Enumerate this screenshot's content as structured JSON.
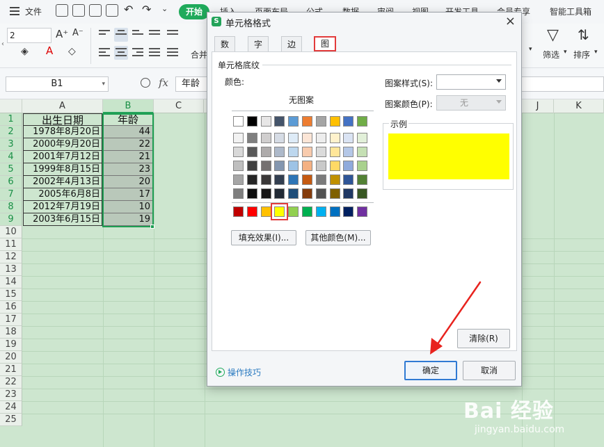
{
  "menubar": {
    "file": "文件",
    "start": "开始",
    "tabs": [
      "插入",
      "页面布局",
      "公式",
      "数据",
      "审阅",
      "视图",
      "开发工具",
      "会员专享",
      "智能工具箱"
    ]
  },
  "ribbon": {
    "font_size": "2",
    "merge_label": "合并",
    "filter_label": "筛选",
    "sort_label": "排序",
    "dropdown_marker": "▾"
  },
  "formula_bar": {
    "cell_ref": "B1",
    "fx": "fx",
    "content": "年龄"
  },
  "sheet": {
    "columns": [
      "A",
      "B",
      "C",
      "J",
      "K"
    ],
    "rows": [
      "1",
      "2",
      "3",
      "4",
      "5",
      "6",
      "7",
      "8",
      "9",
      "10",
      "11",
      "12",
      "13",
      "14",
      "15",
      "16",
      "17",
      "18",
      "19",
      "20",
      "21",
      "22",
      "23",
      "24",
      "25"
    ],
    "header_a": "出生日期",
    "header_b": "年龄",
    "data": [
      {
        "date": "1978年8月20日",
        "age": "44"
      },
      {
        "date": "2000年9月20日",
        "age": "22"
      },
      {
        "date": "2001年7月12日",
        "age": "21"
      },
      {
        "date": "1999年8月15日",
        "age": "23"
      },
      {
        "date": "2002年4月13日",
        "age": "20"
      },
      {
        "date": "2005年6月8日",
        "age": "17"
      },
      {
        "date": "2012年7月19日",
        "age": "10"
      },
      {
        "date": "2003年6月15日",
        "age": "19"
      }
    ]
  },
  "dialog": {
    "title": "单元格格式",
    "close": "×",
    "tabs": [
      "数字",
      "字体",
      "边框",
      "图案"
    ],
    "section": "单元格底纹",
    "color_label": "颜色:",
    "no_pattern": "无图案",
    "pattern_style_label": "图案样式(S):",
    "pattern_color_label": "图案颜色(P):",
    "pattern_color_value": "无",
    "sample_label": "示例",
    "sample_color": "#ffff00",
    "fill_effects": "填充效果(I)...",
    "more_colors": "其他颜色(M)...",
    "clear": "清除(R)",
    "ok": "确定",
    "cancel": "取消",
    "tips": "操作技巧",
    "palette": [
      [
        "#ffffff",
        "#000000",
        "#e7e6e6",
        "#44546a",
        "#5b9bd5",
        "#ed7d31",
        "#a5a5a5",
        "#ffc000",
        "#4472c4",
        "#70ad47"
      ],
      [
        "#f2f2f2",
        "#7f7f7f",
        "#d0cece",
        "#d6dce5",
        "#deebf7",
        "#fbe5d6",
        "#ededed",
        "#fff2cc",
        "#dae3f3",
        "#e2f0d9"
      ],
      [
        "#d9d9d9",
        "#595959",
        "#aeabab",
        "#adb9ca",
        "#bdd7ee",
        "#f8cbad",
        "#dbdbdb",
        "#ffe699",
        "#b4c7e7",
        "#c5e0b4"
      ],
      [
        "#bfbfbf",
        "#404040",
        "#757171",
        "#8497b0",
        "#9dc3e6",
        "#f4b183",
        "#c9c9c9",
        "#ffd966",
        "#8faadc",
        "#a9d18e"
      ],
      [
        "#a6a6a6",
        "#262626",
        "#3a3838",
        "#333f50",
        "#2e75b6",
        "#c55a11",
        "#7b7b7b",
        "#bf9000",
        "#2f5597",
        "#538135"
      ],
      [
        "#7f7f7f",
        "#0d0d0d",
        "#171616",
        "#222a35",
        "#1f4e79",
        "#843c0c",
        "#525252",
        "#7f6000",
        "#203864",
        "#385723"
      ]
    ],
    "standard_colors": [
      "#c00000",
      "#ff0000",
      "#ffc000",
      "#ffff00",
      "#92d050",
      "#00b050",
      "#00b0f0",
      "#0070c0",
      "#002060",
      "#7030a0"
    ],
    "selected_standard_index": 3
  },
  "watermark": {
    "brand": "Bai 经验",
    "url": "jingyan.baidu.com"
  }
}
